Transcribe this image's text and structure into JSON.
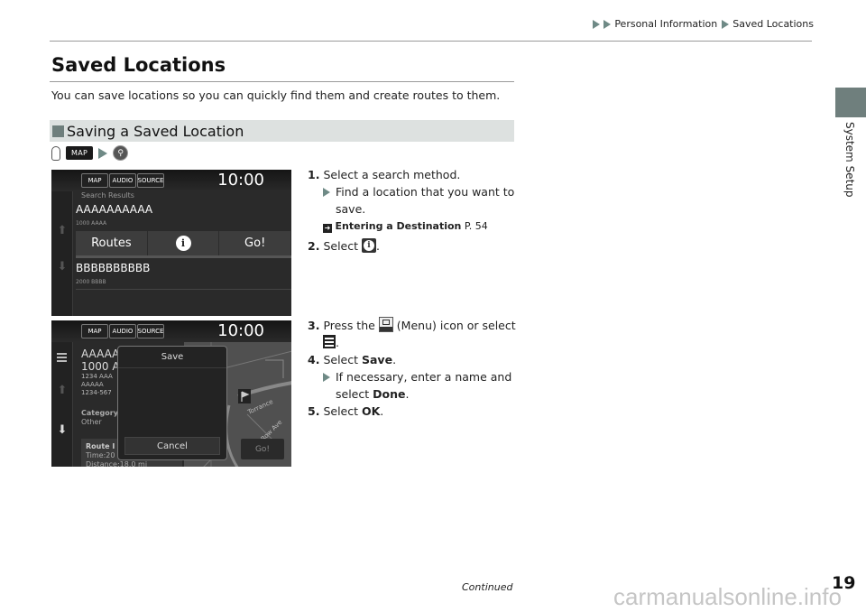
{
  "header": {
    "breadcrumb": [
      "Personal Information",
      "Saved Locations"
    ]
  },
  "side_tab": {
    "label": "System Setup",
    "color": "#6f7f7d"
  },
  "page": {
    "title": "Saved Locations",
    "intro": "You can save locations so you can quickly find them and create routes to them.",
    "section_title": "Saving a Saved Location",
    "path": {
      "button_label": "MAP",
      "icon_after": "search-icon"
    }
  },
  "screen1": {
    "topbar": {
      "buttons": [
        "MAP",
        "AUDIO",
        "SOURCE"
      ],
      "clock": "10:00"
    },
    "search_results_label": "Search Results",
    "items": [
      {
        "title": "AAAAAAAAAA",
        "subtitle": "1000 AAAA"
      },
      {
        "title": "BBBBBBBBBB",
        "subtitle": "2000 BBBB"
      }
    ],
    "actions": {
      "routes": "Routes",
      "info": "i",
      "go": "Go!"
    }
  },
  "screen2": {
    "topbar": {
      "buttons": [
        "MAP",
        "AUDIO",
        "SOURCE"
      ],
      "clock": "10:00"
    },
    "detail": {
      "title_line1": "AAAAA",
      "title_line2": "1000 A",
      "address": [
        "1234 AAA",
        "AAAAA",
        "1234-567"
      ],
      "category_label": "Category",
      "category_value": "Other",
      "route_label": "Route I",
      "route_time": "Time:20",
      "route_distance": "Distance:18.0 mi"
    },
    "dialog": {
      "title": "Save",
      "cancel": "Cancel"
    },
    "map_labels": [
      "Torrance",
      "Row Ave"
    ],
    "go": "Go!"
  },
  "steps": {
    "s1": {
      "num": "1.",
      "text": "Select a search method."
    },
    "s1_sub": "Find a location that you want to save.",
    "s1_xref": {
      "title": "Entering a Destination",
      "page": "P. 54"
    },
    "s2": {
      "num": "2.",
      "text": "Select",
      "suffix": "."
    },
    "s3": {
      "num": "3.",
      "text_a": "Press the",
      "text_b": "(Menu) icon or select",
      "suffix": "."
    },
    "s4": {
      "num": "4.",
      "text": "Select",
      "bold": "Save",
      "suffix": "."
    },
    "s4_sub": {
      "text": "If necessary, enter a name and select",
      "bold": "Done",
      "suffix": "."
    },
    "s5": {
      "num": "5.",
      "text": "Select",
      "bold": "OK",
      "suffix": "."
    }
  },
  "footer": {
    "continued": "Continued",
    "page_number": "19",
    "watermark": "carmanualsonline.info"
  }
}
